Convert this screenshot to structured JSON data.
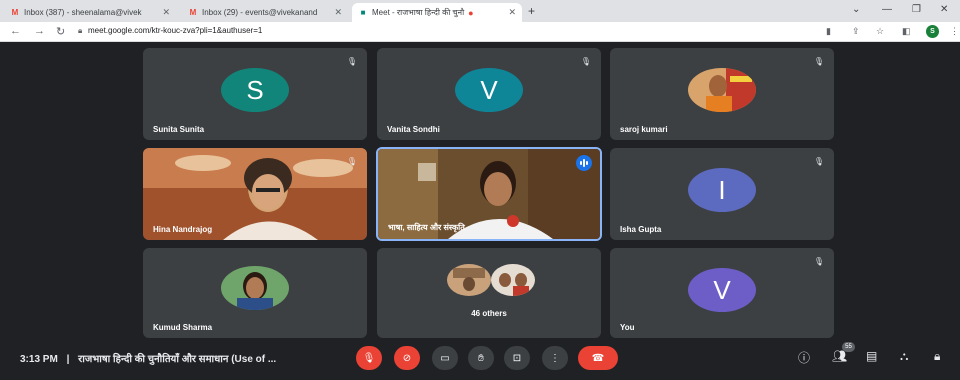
{
  "browser": {
    "tabs": [
      {
        "label": "Inbox (387) - sheenalama@vivek",
        "icon": "gmail-icon"
      },
      {
        "label": "Inbox (29) - events@vivekanand",
        "icon": "gmail-icon"
      },
      {
        "label": "Meet - राजभाषा हिन्दी की चुनौ",
        "icon": "meet-icon"
      }
    ],
    "url": "meet.google.com/ktr-kouc-zva?pli=1&authuser=1",
    "profile_initial": "S"
  },
  "tiles": [
    {
      "name": "Sunita Sunita",
      "initial": "S",
      "color": "#12857a"
    },
    {
      "name": "Vanita Sondhi",
      "initial": "V",
      "color": "#0f8598"
    },
    {
      "name": "saroj kumari"
    },
    {
      "name": "Hina Nandrajog"
    },
    {
      "name": "भाषा, साहित्य और संस्कृति"
    },
    {
      "name": "Isha Gupta",
      "initial": "I",
      "color": "#5c6bc0"
    },
    {
      "name": "Kumud Sharma"
    },
    {
      "name": "46 others"
    },
    {
      "name": "You",
      "initial": "V",
      "color": "#6d5ec7"
    }
  ],
  "bottom": {
    "time": "3:13 PM",
    "separator": "|",
    "meeting_title": "राजभाषा हिन्दी की चुनौतियाँ और समाधान (Use of ...",
    "participant_count": "55"
  }
}
